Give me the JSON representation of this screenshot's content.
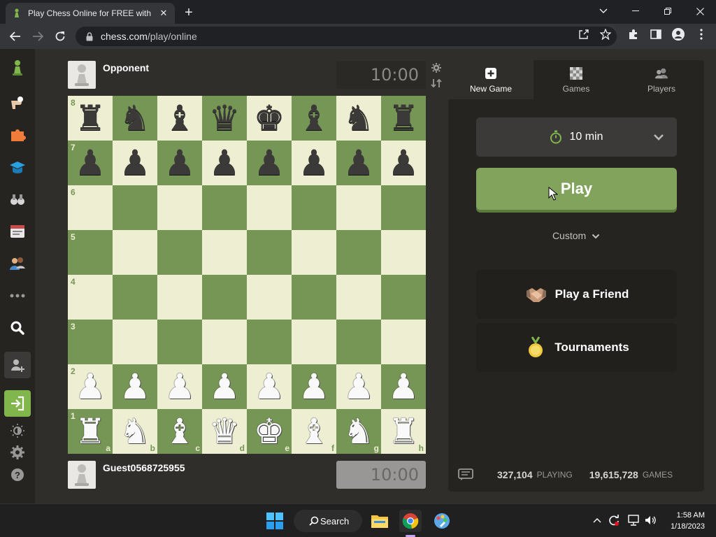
{
  "browser": {
    "tab_title": "Play Chess Online for FREE with F",
    "url_domain": "chess.com",
    "url_path": "/play/online"
  },
  "sidebar": {
    "items": [
      "pawn-logo-icon",
      "puzzle-icon",
      "learn-icon",
      "lessons-icon",
      "watch-icon",
      "news-icon",
      "social-icon",
      "more-icon",
      "search-icon",
      "signup-icon",
      "login-icon",
      "theme-icon",
      "settings-icon",
      "help-icon"
    ]
  },
  "game": {
    "opponent_name": "Opponent",
    "opponent_clock": "10:00",
    "player_name": "Guest0568725955",
    "player_clock": "10:00",
    "ranks": [
      "8",
      "7",
      "6",
      "5",
      "4",
      "3",
      "2",
      "1"
    ],
    "files": [
      "a",
      "b",
      "c",
      "d",
      "e",
      "f",
      "g",
      "h"
    ],
    "position": [
      [
        "r",
        "n",
        "b",
        "q",
        "k",
        "b",
        "n",
        "r"
      ],
      [
        "p",
        "p",
        "p",
        "p",
        "p",
        "p",
        "p",
        "p"
      ],
      [
        "",
        "",
        "",
        "",
        "",
        "",
        "",
        ""
      ],
      [
        "",
        "",
        "",
        "",
        "",
        "",
        "",
        ""
      ],
      [
        "",
        "",
        "",
        "",
        "",
        "",
        "",
        ""
      ],
      [
        "",
        "",
        "",
        "",
        "",
        "",
        "",
        ""
      ],
      [
        "P",
        "P",
        "P",
        "P",
        "P",
        "P",
        "P",
        "P"
      ],
      [
        "R",
        "N",
        "B",
        "Q",
        "K",
        "B",
        "N",
        "R"
      ]
    ]
  },
  "panel": {
    "tabs": [
      {
        "label": "New Game",
        "icon": "plus-square-icon",
        "active": true
      },
      {
        "label": "Games",
        "icon": "board-icon",
        "active": false
      },
      {
        "label": "Players",
        "icon": "players-icon",
        "active": false
      }
    ],
    "time_control": "10 min",
    "play_label": "Play",
    "custom_label": "Custom",
    "play_friend_label": "Play a Friend",
    "tournaments_label": "Tournaments",
    "stats": {
      "playing_count": "327,104",
      "playing_label": "PLAYING",
      "games_count": "19,615,728",
      "games_label": "GAMES"
    }
  },
  "taskbar": {
    "search_label": "Search",
    "time": "1:58 AM",
    "date": "1/18/2023"
  },
  "colors": {
    "light_square": "#eeeed2",
    "dark_square": "#769656",
    "play_button": "#81a35c"
  }
}
